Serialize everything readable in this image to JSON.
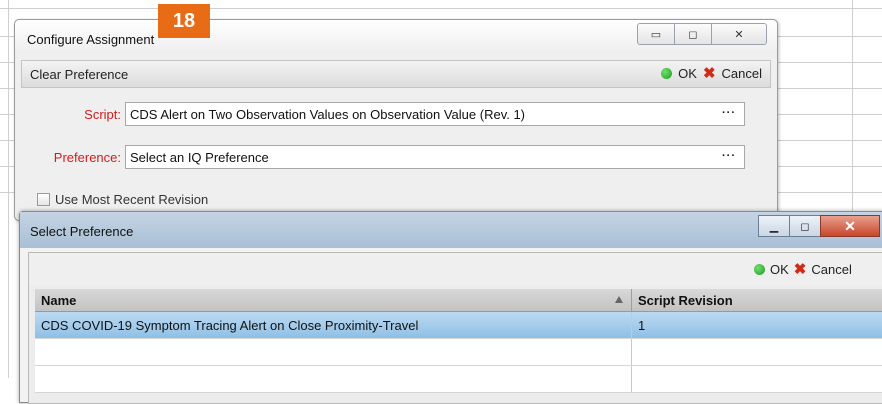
{
  "configure_window": {
    "title": "Configure Assignment",
    "buttons": {
      "minimize": "▭",
      "maximize": "◻",
      "close": "✕"
    },
    "section_title": "Clear Preference",
    "ok_label": "OK",
    "cancel_label": "Cancel",
    "script_label": "Script:",
    "script_value": "CDS Alert on Two Observation Values on Observation Value (Rev. 1)",
    "preference_label": "Preference:",
    "preference_value": "Select an IQ Preference",
    "ellipsis": "···",
    "checkbox_label": "Use Most Recent Revision"
  },
  "step_badge": "18",
  "select_window": {
    "title": "Select Preference",
    "buttons": {
      "minimize": "▁",
      "maximize": "◻",
      "close": "✕"
    },
    "ok_label": "OK",
    "cancel_label": "Cancel",
    "columns": [
      "Name",
      "Script Revision"
    ],
    "rows": [
      {
        "name": "CDS COVID-19 Symptom Tracing Alert on Close Proximity-Travel",
        "revision": "1",
        "selected": true
      },
      {
        "name": "",
        "revision": "",
        "selected": false
      },
      {
        "name": "",
        "revision": "",
        "selected": false
      }
    ]
  },
  "colors": {
    "accent": "#e86b16",
    "required_label": "#d21c1c",
    "selection": "#8fc0e6",
    "ok_green": "#1f9a1f",
    "cancel_red": "#d42a14"
  }
}
